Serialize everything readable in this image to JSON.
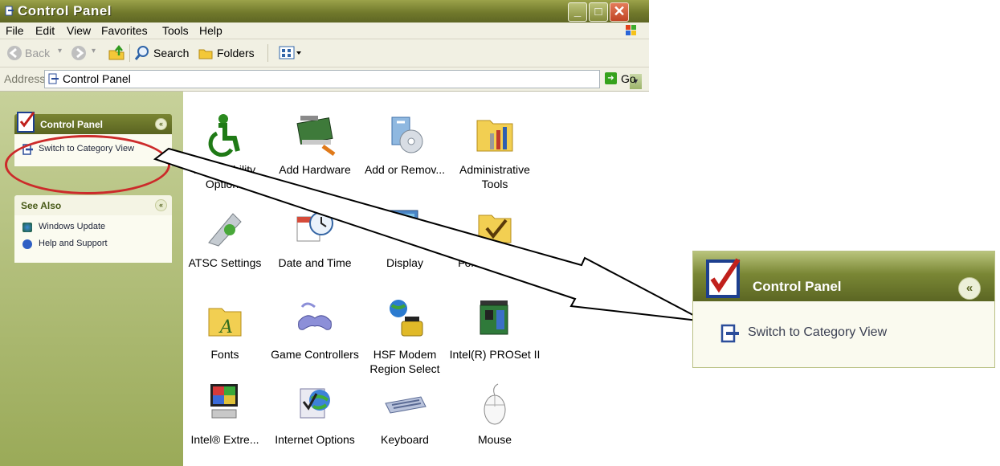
{
  "window": {
    "title": "Control Panel",
    "menu": [
      "File",
      "Edit",
      "View",
      "Favorites",
      "Tools",
      "Help"
    ],
    "toolbar": {
      "back": "Back",
      "search": "Search",
      "folders": "Folders"
    },
    "address": {
      "label": "Address",
      "value": "Control Panel",
      "go": "Go"
    }
  },
  "taskpane": {
    "control_panel": {
      "title": "Control Panel",
      "link": "Switch to Category View"
    },
    "see_also": {
      "title": "See Also",
      "links": [
        "Windows Update",
        "Help and Support"
      ]
    }
  },
  "items": [
    {
      "label": "Accessibility Options",
      "icon": "accessibility-icon"
    },
    {
      "label": "Add Hardware",
      "icon": "add-hardware-icon"
    },
    {
      "label": "Add or Remov...",
      "icon": "add-remove-programs-icon"
    },
    {
      "label": "Administrative Tools",
      "icon": "administrative-tools-icon"
    },
    {
      "label": "ATSC Settings",
      "icon": "atsc-settings-icon"
    },
    {
      "label": "Date and Time",
      "icon": "date-time-icon"
    },
    {
      "label": "Display",
      "icon": "display-icon"
    },
    {
      "label": "Folder Options",
      "icon": "folder-options-icon"
    },
    {
      "label": "Fonts",
      "icon": "fonts-icon"
    },
    {
      "label": "Game Controllers",
      "icon": "game-controllers-icon"
    },
    {
      "label": "HSF Modem Region Select",
      "icon": "modem-icon"
    },
    {
      "label": "Intel(R) PROSet II",
      "icon": "network-card-icon"
    },
    {
      "label": "Intel® Extre...",
      "icon": "intel-graphics-icon"
    },
    {
      "label": "Internet Options",
      "icon": "internet-options-icon"
    },
    {
      "label": "Keyboard",
      "icon": "keyboard-icon"
    },
    {
      "label": "Mouse",
      "icon": "mouse-icon"
    }
  ],
  "zoom": {
    "title": "Control Panel",
    "link": "Switch to Category View"
  },
  "colors": {
    "title_bar": "#727a2c",
    "task_pane": "#b3c07c",
    "highlight_ellipse": "#cc2a2a"
  }
}
